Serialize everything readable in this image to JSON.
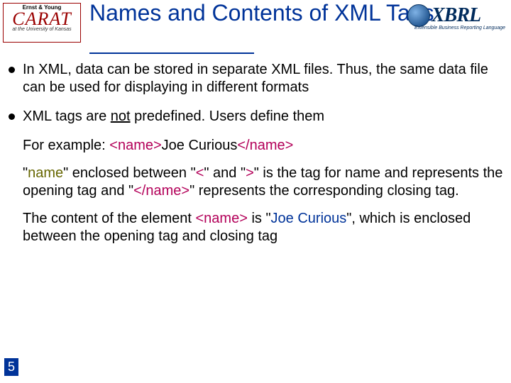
{
  "header": {
    "carat_ey": "Ernst & Young",
    "carat_main": "CARAT",
    "carat_sub1": "at the University of Kansas",
    "title_line": "Names and Contents of XML Tags",
    "xbrl_text": "XBRL",
    "xbrl_sub": "Extensible Business Reporting Language"
  },
  "bullets": [
    "In XML, data can be stored in separate XML files. Thus, the same data file can be used for displaying in different formats",
    "XML tags are "
  ],
  "bullet2_not": "not",
  "bullet2_rest": " predefined. Users define them",
  "example_label": "For example:  ",
  "ex_open": "<name>",
  "ex_content": "Joe Curious",
  "ex_close": "</name>",
  "para3_a": "\"",
  "para3_name1": "name",
  "para3_b": "\" enclosed between \"",
  "para3_lt": "<",
  "para3_c": "\" and \"",
  "para3_gt": ">",
  "para3_d": "\" is the tag for name and represents the opening tag and \"",
  "para3_closename": "</name>",
  "para3_e": "\" represents the corresponding closing tag.",
  "para4_a": "The content of the element ",
  "para4_name": "<name>",
  "para4_b": " is \"",
  "para4_joe": "Joe Curious",
  "para4_c": "\", which is enclosed between the opening tag and closing tag",
  "page_number": "5"
}
